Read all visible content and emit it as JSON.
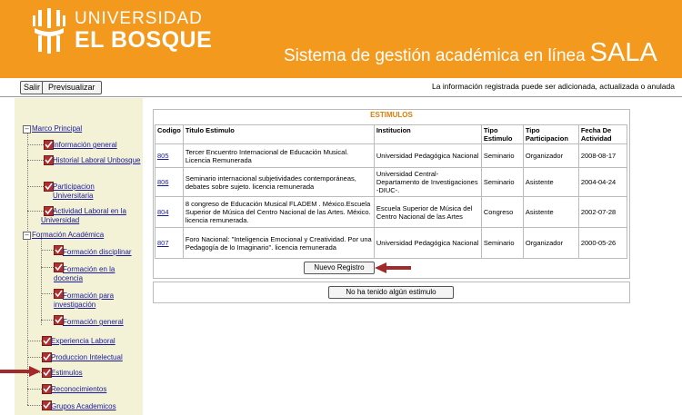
{
  "header": {
    "logo_line1": "UNIVERSIDAD",
    "logo_line2": "EL BOSQUE",
    "system_title": "Sistema de gestión académica en línea",
    "system_brand": "SALA",
    "brand_color": "#f39a1e"
  },
  "toolbar": {
    "salir_label": "Salir",
    "previsualizar_label": "Previsualizar",
    "info_text": "La información registrada puede ser adicionada, actualizada o anulada"
  },
  "sidebar": {
    "root": "Marco Principal",
    "items": [
      {
        "label": "Información general"
      },
      {
        "label": "Historial Laboral Unbosque"
      },
      {
        "label": "Participacion Universitaria"
      },
      {
        "label": "Actividad Laboral en la Universidad"
      }
    ],
    "formacion": {
      "label": "Formación Académica",
      "items": [
        {
          "label": "Formación disciplinar"
        },
        {
          "label": "Formación en la docencia"
        },
        {
          "label": "Formación para investigación"
        },
        {
          "label": "Formación general"
        }
      ]
    },
    "bottom_items": [
      {
        "label": "Experiencia Laboral"
      },
      {
        "label": "Produccion Intelectual"
      },
      {
        "label": "Estimulos"
      },
      {
        "label": "Reconocimientos"
      },
      {
        "label": "Grupos Academicos"
      }
    ]
  },
  "panel": {
    "title": "ESTIMULOS",
    "columns": [
      "Codigo",
      "Titulo Estimulo",
      "Institucion",
      "Tipo Estimulo",
      "Tipo Participacion",
      "Fecha De Actividad"
    ],
    "rows": [
      {
        "codigo": "805",
        "titulo": "Tercer Encuentro Internacional de Educación Musical. Licencia Remunerada",
        "institucion": "Universidad Pedagógica Nacional",
        "tipo": "Seminario",
        "participacion": "Organizador",
        "fecha": "2008-08-17"
      },
      {
        "codigo": "806",
        "titulo": "Seminario internacional subjetividades contemporáneas, debates sobre sujeto. licencia remunerada",
        "institucion": "Universidad Central- Departamento de Investigaciones -DIUC-.",
        "tipo": "Seminario",
        "participacion": "Asistente",
        "fecha": "2004-04-24"
      },
      {
        "codigo": "804",
        "titulo": "8 congreso de Educación Musical FLADEM . México.Escuela Superior de Música del Centro Nacional de las Artes. México. licencia remunerada.",
        "institucion": "Escuela Superior de Música del Centro Nacional de las Artes",
        "tipo": "Congreso",
        "participacion": "Asistente",
        "fecha": "2002-07-28"
      },
      {
        "codigo": "807",
        "titulo": "Foro Nacional: \"Inteligencia Emocional y Creatividad. Por una Pedagogía de lo Imaginario\". licencia remunerada",
        "institucion": "Universidad Pedagógica Nacional",
        "tipo": "Seminario",
        "participacion": "Organizador",
        "fecha": "2000-05-26"
      }
    ],
    "new_button": "Nuevo Registro",
    "none_button": "No ha tenido algún estimulo"
  }
}
